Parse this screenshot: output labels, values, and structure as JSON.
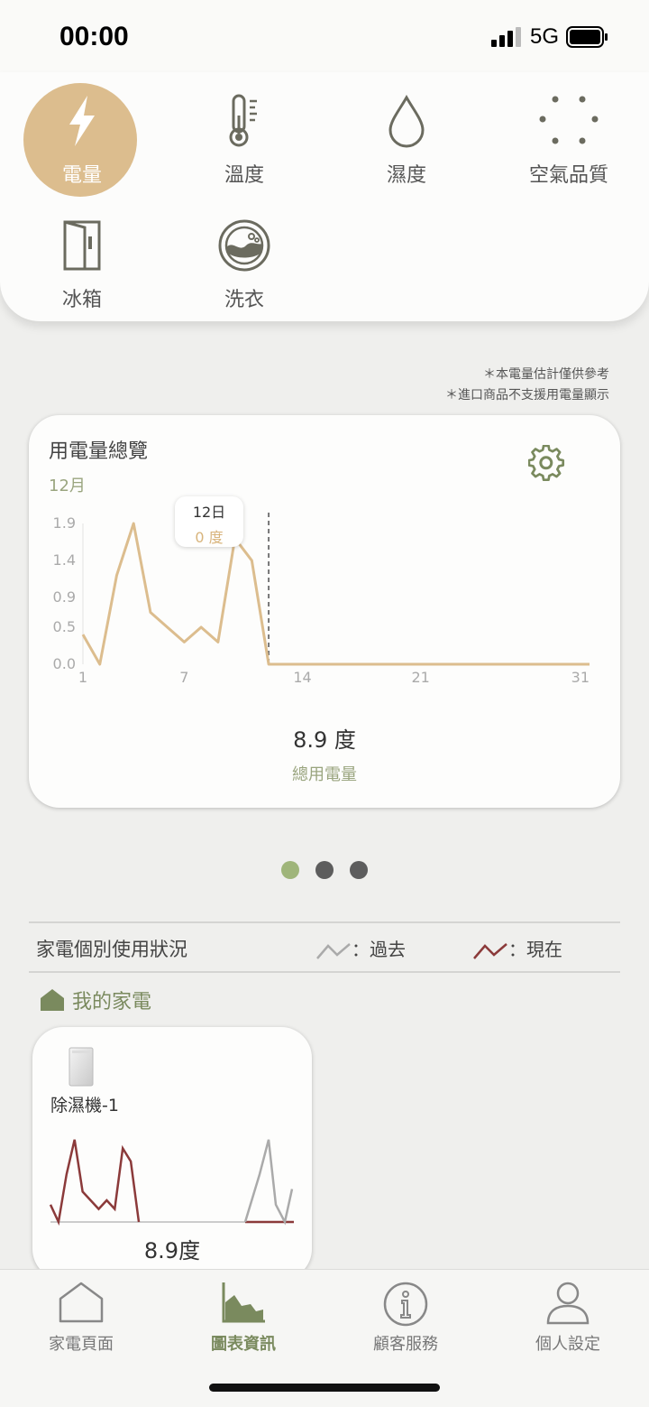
{
  "status": {
    "time": "00:00",
    "network": "5G"
  },
  "categories": [
    {
      "label": "電量",
      "icon": "lightning-icon",
      "active": true
    },
    {
      "label": "溫度",
      "icon": "thermometer-icon",
      "active": false
    },
    {
      "label": "濕度",
      "icon": "water-drop-icon",
      "active": false
    },
    {
      "label": "空氣品質",
      "icon": "air-dots-icon",
      "active": false
    },
    {
      "label": "冰箱",
      "icon": "fridge-icon",
      "active": false
    },
    {
      "label": "洗衣",
      "icon": "washer-icon",
      "active": false
    }
  ],
  "notes": {
    "line1": "＊本電量估計僅供參考",
    "line2": "＊進口商品不支援用電量顯示"
  },
  "overview": {
    "title": "用電量總覽",
    "month": "12月",
    "tooltip": {
      "day": "12日",
      "value": "0 度"
    },
    "total_value": "8.9 度",
    "total_label": "總用電量"
  },
  "chart_data": {
    "type": "line",
    "x_ticks": [
      "1",
      "7",
      "14",
      "21",
      "31"
    ],
    "y_ticks": [
      "0.0",
      "0.5",
      "0.9",
      "1.4",
      "1.9"
    ],
    "ylim": [
      0,
      1.9
    ],
    "xlim": [
      1,
      31
    ],
    "x": [
      1,
      2,
      3,
      4,
      5,
      6,
      7,
      8,
      9,
      10,
      11,
      12,
      13,
      14,
      15,
      16,
      17,
      18,
      19,
      20,
      21,
      22,
      23,
      24,
      25,
      26,
      27,
      28,
      29,
      30,
      31
    ],
    "values": [
      0.4,
      0.0,
      1.2,
      1.9,
      0.7,
      0.5,
      0.3,
      0.5,
      0.3,
      1.7,
      1.4,
      0,
      0,
      0,
      0,
      0,
      0,
      0,
      0,
      0,
      0,
      0,
      0,
      0,
      0,
      0,
      0,
      0,
      0,
      0,
      0
    ],
    "selected_day": 12,
    "color": "#dcbd8e"
  },
  "pager": {
    "count": 3,
    "active": 0
  },
  "usage": {
    "label": "家電個別使用狀況",
    "legend_past": "：過去",
    "legend_now": "：現在",
    "past_color": "#aaaaaa",
    "now_color": "#8b3a3a"
  },
  "my_appliances": {
    "label": "我的家電"
  },
  "device": {
    "name": "除濕機-1",
    "value": "8.9度",
    "past": [
      0.85,
      0.55,
      0.5,
      0.75,
      0.95,
      0.9,
      0.7,
      0.4,
      0.05
    ],
    "now": [
      0.2,
      0.0,
      0.55,
      0.95,
      0.35,
      0.25,
      0.15,
      0.25,
      0.15,
      0.85,
      0.7,
      0.0
    ]
  },
  "tabs": [
    {
      "label": "家電頁面",
      "icon": "house-icon",
      "active": false
    },
    {
      "label": "圖表資訊",
      "icon": "chart-icon",
      "active": true
    },
    {
      "label": "顧客服務",
      "icon": "info-icon",
      "active": false
    },
    {
      "label": "個人設定",
      "icon": "person-icon",
      "active": false
    }
  ],
  "colors": {
    "accent": "#dcbd8e",
    "green": "#7a8a5e",
    "icon": "#6b6b5f"
  }
}
